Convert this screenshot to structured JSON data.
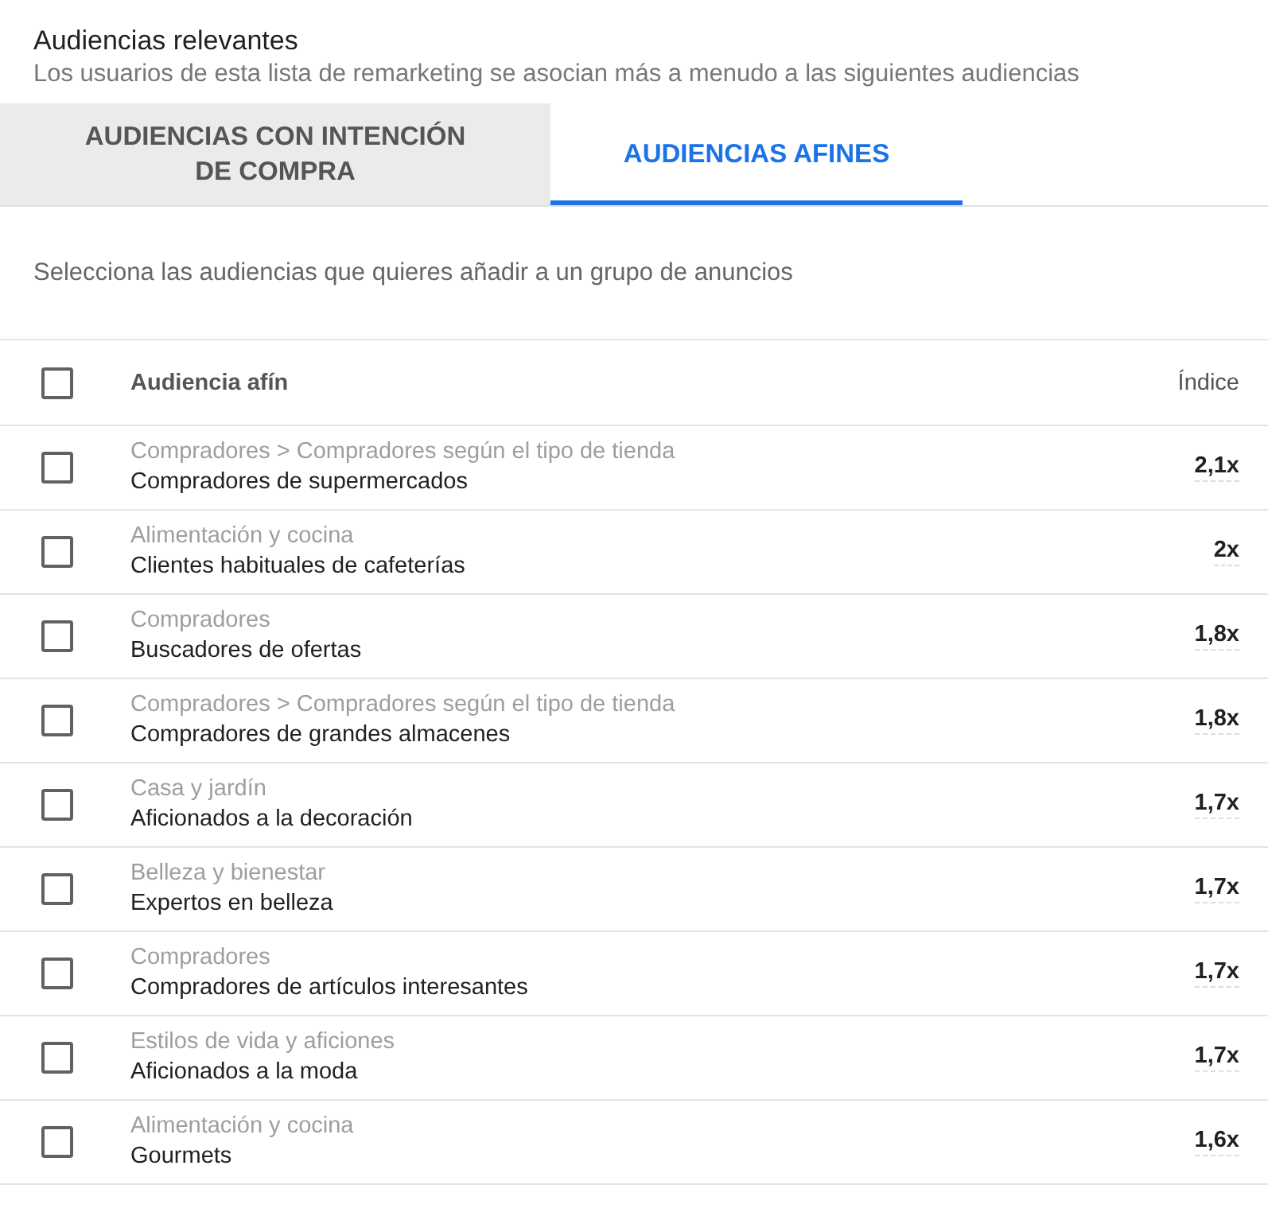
{
  "header": {
    "title": "Audiencias relevantes",
    "subtitle": "Los usuarios de esta lista de remarketing se asocian más a menudo a las siguientes audiencias"
  },
  "tabs": [
    {
      "label": "AUDIENCIAS CON INTENCIÓN DE COMPRA",
      "selected": false
    },
    {
      "label": "AUDIENCIAS AFINES",
      "selected": true
    }
  ],
  "hint": "Selecciona las audiencias que quieres añadir a un grupo de anuncios",
  "table": {
    "select_all": {
      "checked": false
    },
    "columns": [
      "Audiencia afín",
      "Índice"
    ],
    "rows": [
      {
        "category": "Compradores > Compradores según el tipo de tienda",
        "name": "Compradores de supermercados",
        "index": "2,1x",
        "checked": false
      },
      {
        "category": "Alimentación y cocina",
        "name": "Clientes habituales de cafeterías",
        "index": "2x",
        "checked": false
      },
      {
        "category": "Compradores",
        "name": "Buscadores de ofertas",
        "index": "1,8x",
        "checked": false
      },
      {
        "category": "Compradores > Compradores según el tipo de tienda",
        "name": "Compradores de grandes almacenes",
        "index": "1,8x",
        "checked": false
      },
      {
        "category": "Casa y jardín",
        "name": "Aficionados a la decoración",
        "index": "1,7x",
        "checked": false
      },
      {
        "category": "Belleza y bienestar",
        "name": "Expertos en belleza",
        "index": "1,7x",
        "checked": false
      },
      {
        "category": "Compradores",
        "name": "Compradores de artículos interesantes",
        "index": "1,7x",
        "checked": false
      },
      {
        "category": "Estilos de vida y aficiones",
        "name": "Aficionados a la moda",
        "index": "1,7x",
        "checked": false
      },
      {
        "category": "Alimentación y cocina",
        "name": "Gourmets",
        "index": "1,6x",
        "checked": false
      }
    ]
  }
}
